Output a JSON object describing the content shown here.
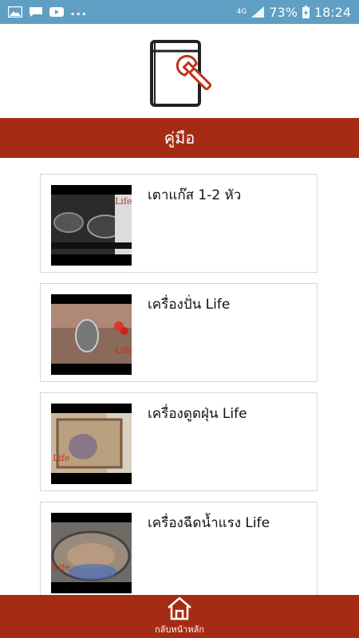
{
  "status_bar": {
    "network": "4G",
    "battery": "73%",
    "time": "18:24",
    "overflow": "..."
  },
  "header": {
    "title": "คู่มือ"
  },
  "items": [
    {
      "title": "เตาแก๊ส 1-2 หัว",
      "thumb_text": "Life"
    },
    {
      "title": "เครื่องปั่น Life",
      "thumb_text": "Life"
    },
    {
      "title": "เครื่องดูดฝุ่น Life",
      "thumb_text": "Life"
    },
    {
      "title": "เครื่องฉีดน้ำแรง Life",
      "thumb_text": "Life"
    }
  ],
  "bottom_nav": {
    "home_label": "กลับหน้าหลัก"
  },
  "colors": {
    "status_bar": "#5f9fc4",
    "primary": "#a62b14",
    "accent_logo": "#c2311b"
  }
}
